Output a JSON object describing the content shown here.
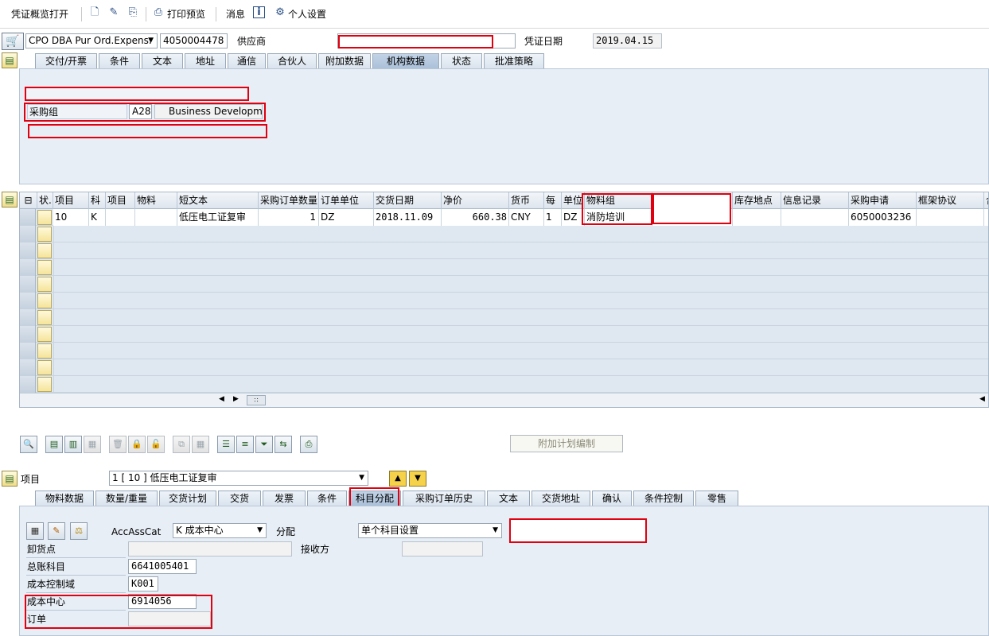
{
  "toolbar": {
    "overview_label": "凭证概览打开",
    "print_preview_label": "打印预览",
    "messages_label": "消息",
    "personal_settings_label": "个人设置"
  },
  "header": {
    "doc_type": "CPO DBA Pur Ord.Expens.",
    "po_number": "4050004478",
    "vendor_label": "供应商",
    "vendor_value": "",
    "doc_date_label": "凭证日期",
    "doc_date_value": "2019.04.15"
  },
  "header_tabs": [
    {
      "label": "交付/开票"
    },
    {
      "label": "条件"
    },
    {
      "label": "文本"
    },
    {
      "label": "地址"
    },
    {
      "label": "通信"
    },
    {
      "label": "合伙人"
    },
    {
      "label": "附加数据"
    },
    {
      "label": "机构数据"
    },
    {
      "label": "状态"
    },
    {
      "label": "批准策略"
    }
  ],
  "org_data": {
    "purch_group_label": "采购组",
    "purch_group_code": "A28",
    "purch_group_desc": "Business Developme"
  },
  "grid": {
    "columns": [
      "状.",
      "项目",
      "科",
      "项目",
      "物料",
      "短文本",
      "采购订单数量",
      "订单单位",
      "交货日期",
      "净价",
      "货币",
      "每",
      "单位",
      "物料组",
      "",
      "库存地点",
      "信息记录",
      "采购申请",
      "框架协议",
      "合"
    ],
    "row": {
      "item": "10",
      "acct_cat": "K",
      "short_text": "低压电工证复审",
      "quantity": "1",
      "order_unit": "DZ",
      "delivery_date": "2018.11.09",
      "net_price": "660.38",
      "currency": "CNY",
      "per": "1",
      "unit": "DZ",
      "material_group": "消防培训",
      "purchase_req": "6050003236"
    }
  },
  "item_bar": {
    "schedule_button": "附加计划编制",
    "item_label": "项目",
    "item_value": "1 [ 10 ] 低压电工证复审"
  },
  "item_tabs": [
    {
      "label": "物料数据"
    },
    {
      "label": "数量/重量"
    },
    {
      "label": "交货计划"
    },
    {
      "label": "交货"
    },
    {
      "label": "发票"
    },
    {
      "label": "条件"
    },
    {
      "label": "科目分配"
    },
    {
      "label": "采购订单历史"
    },
    {
      "label": "文本"
    },
    {
      "label": "交货地址"
    },
    {
      "label": "确认"
    },
    {
      "label": "条件控制"
    },
    {
      "label": "零售"
    }
  ],
  "account_assignment": {
    "acc_cat_label": "AccAssCat",
    "acc_cat_value": "K 成本中心",
    "distribution_label": "分配",
    "distribution_value": "单个科目设置",
    "unloading_point_label": "卸货点",
    "unloading_point_value": "",
    "recipient_label": "接收方",
    "recipient_value": "",
    "gl_account_label": "总账科目",
    "gl_account_value": "6641005401",
    "co_area_label": "成本控制域",
    "co_area_value": "K001",
    "cost_center_label": "成本中心",
    "cost_center_value": "6914056",
    "order_label": "订单",
    "order_value": ""
  }
}
